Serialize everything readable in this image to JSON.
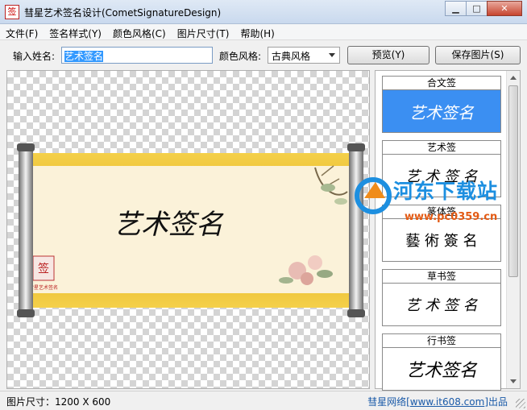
{
  "window": {
    "title": "彗星艺术签名设计(CometSignatureDesign)",
    "app_icon_char": "签"
  },
  "window_buttons": {
    "minimize": "▁",
    "maximize": "□",
    "close": "✕"
  },
  "menu": [
    "文件(F)",
    "签名样式(Y)",
    "颜色风格(C)",
    "图片尺寸(T)",
    "帮助(H)"
  ],
  "toolbar": {
    "name_label": "输入姓名:",
    "name_value": "艺术签名",
    "color_label": "颜色风格:",
    "color_value": "古典风格",
    "preview_label": "预览(Y)",
    "save_label": "保存图片(S)"
  },
  "canvas": {
    "signature_text": "艺术签名",
    "seal_char": "签",
    "seal_caption": "彗星艺术签名"
  },
  "styles": [
    {
      "title": "合文签",
      "sample": "艺术签名",
      "selected": true
    },
    {
      "title": "艺术签",
      "sample": "艺 术 签 名",
      "selected": false
    },
    {
      "title": "篆体签",
      "sample": "藝 術 簽 名",
      "selected": false
    },
    {
      "title": "草书签",
      "sample": "艺 术 签 名",
      "selected": false
    },
    {
      "title": "行书签",
      "sample": "艺术签名",
      "selected": false
    }
  ],
  "watermark": {
    "title": "河东下载站",
    "url": "www.pc0359.cn"
  },
  "status": {
    "size_text": "图片尺寸：1200 X 600",
    "credit_prefix": "彗星网络[",
    "credit_url": "www.it608.com",
    "credit_suffix": "]出品"
  },
  "colors": {
    "selected_card": "#3b8ff2",
    "scroll_gold": "#e8b820",
    "link": "#1a5aa8"
  }
}
